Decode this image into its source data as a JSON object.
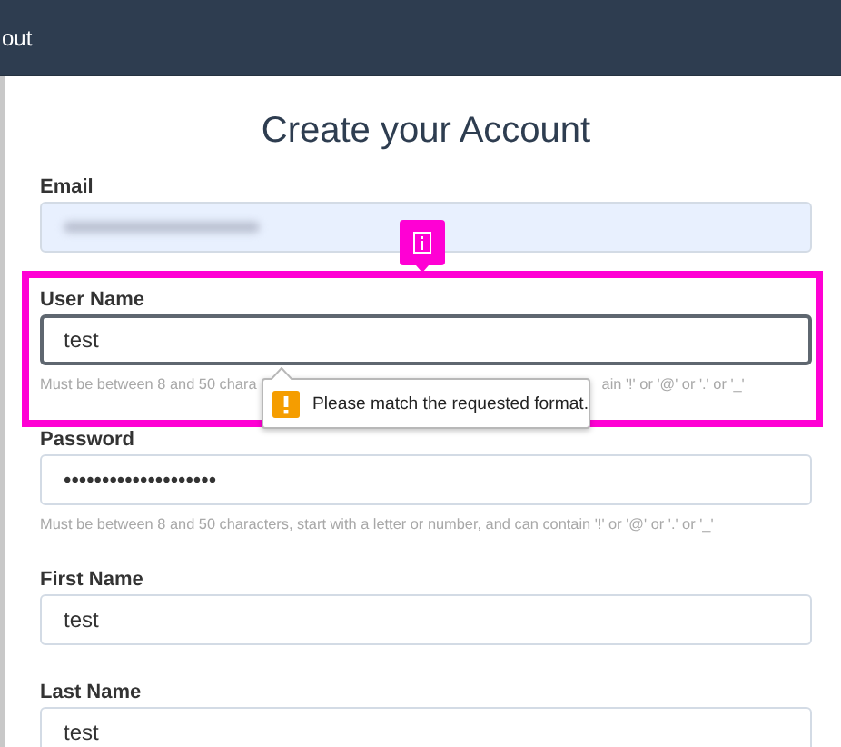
{
  "header": {
    "nav_text": "out"
  },
  "title": "Create your Account",
  "fields": [
    {
      "label": "Email",
      "kind": "blurred"
    },
    {
      "label": "User Name",
      "kind": "text",
      "value": "test",
      "focused": true,
      "hint_parts": [
        "Must be between 8 and 50 chara",
        "ain '!' or '@' or '.' or '_'"
      ]
    },
    {
      "label": "Password",
      "kind": "text",
      "value": "••••••••••••••••••••",
      "focused": false,
      "hint_parts": [
        "Must be between 8 and 50 characters, start with a letter or number, and can contain '!' or '@' or '.' or '_'"
      ]
    },
    {
      "label": "First Name",
      "kind": "text",
      "value": "test",
      "focused": false
    },
    {
      "label": "Last Name",
      "kind": "text",
      "value": "test",
      "focused": false
    }
  ],
  "tooltip": {
    "message": "Please match the requested format."
  }
}
